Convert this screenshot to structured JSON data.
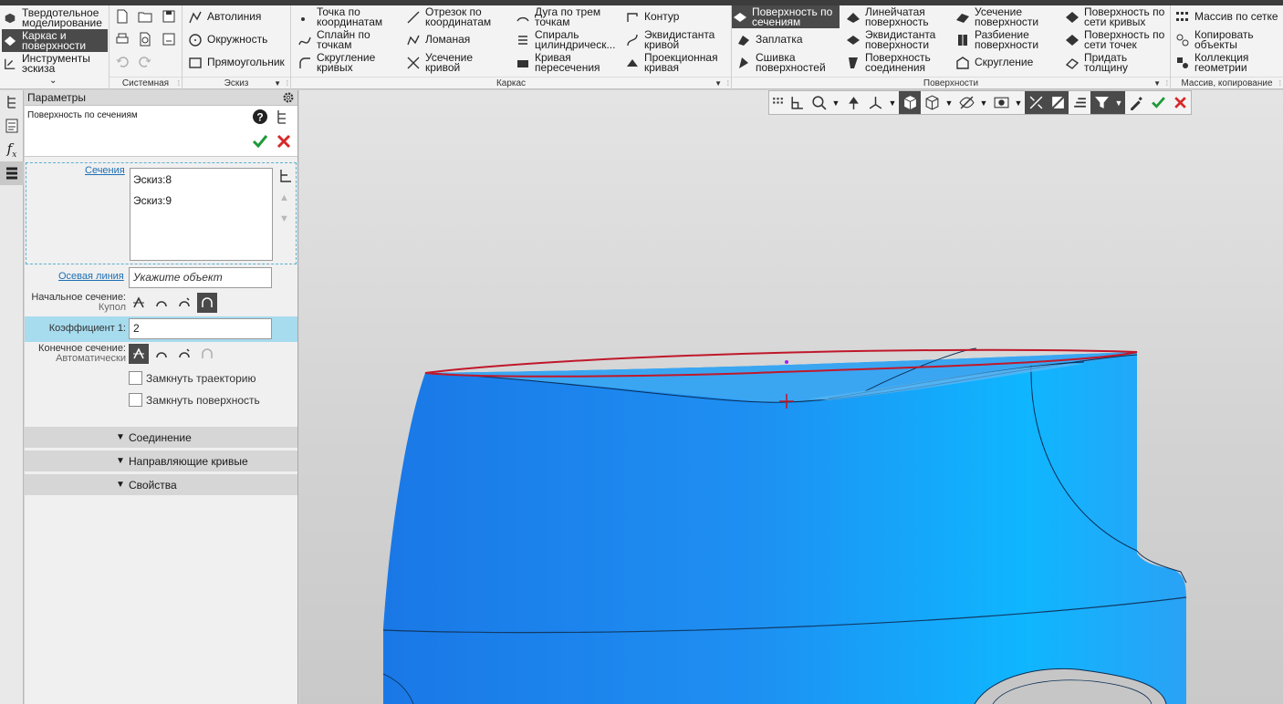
{
  "colors": {
    "accent_dark": "#4a4a4a",
    "highlight_row": "#a7dbee",
    "model_blue": "#2a9ff0",
    "edge_red": "#c0182a",
    "ok_green": "#1f9a3a",
    "cancel_red": "#d62828",
    "link_blue": "#1e6fb3"
  },
  "ribbon": {
    "modes": [
      {
        "label": "Твердотельное\nмоделирование",
        "icon": "solid-icon",
        "active": false
      },
      {
        "label": "Каркас и\nповерхности",
        "icon": "surface-mode-icon",
        "active": true
      },
      {
        "label": "Инструменты\nэскиза",
        "icon": "sketch-tools-icon",
        "active": false
      }
    ],
    "groups": {
      "system": "Системная",
      "sketch": "Эскиз",
      "frame": "Каркас",
      "surfaces": "Поверхности",
      "pattern": "Массив, копирование"
    },
    "sketch_buttons": [
      "Автолиния",
      "Окружность",
      "Прямоугольник"
    ],
    "frame_buttons": [
      "Точка по\nкоординатам",
      "Отрезок по\nкоординатам",
      "Дуга по трем\nточкам",
      "Контур",
      "Сплайн по\nточкам",
      "Ломаная",
      "Спираль\nцилиндрическ...",
      "Эквидистанта\nкривой",
      "Скругление\nкривых",
      "Усечение\nкривой",
      "Кривая\nпересечения",
      "Проекционная\nкривая"
    ],
    "surface_buttons": [
      "Поверхность по\nсечениям",
      "Линейчатая\nповерхность",
      "Усечение\nповерхности",
      "Поверхность по\nсети кривых",
      "Заплатка",
      "Эквидистанта\nповерхности",
      "Разбиение\nповерхности",
      "Поверхность по\nсети точек",
      "Сшивка\nповерхностей",
      "Поверхность\nсоединения",
      "Скругление",
      "Придать\nтолщину"
    ],
    "pattern_buttons": [
      "Массив по сетке",
      "Копировать\nобъекты",
      "Коллекция\nгеометрии"
    ]
  },
  "panel": {
    "header": "Параметры",
    "operation": "Поверхность по сечениям",
    "sections_label": "Сечения",
    "sections": [
      "Эскиз:8",
      "Эскиз:9"
    ],
    "axis_label": "Осевая линия",
    "axis_placeholder": "Укажите объект",
    "start_label": "Начальное сечение:",
    "start_value": "Купол",
    "coef_label": "Коэффициент 1:",
    "coef_value": "2",
    "end_label": "Конечное сечение:",
    "end_value": "Автоматически",
    "close_trajectory": "Замкнуть траекторию",
    "close_surface": "Замкнуть поверхность",
    "sections_more": [
      "Соединение",
      "Направляющие кривые",
      "Свойства"
    ]
  }
}
